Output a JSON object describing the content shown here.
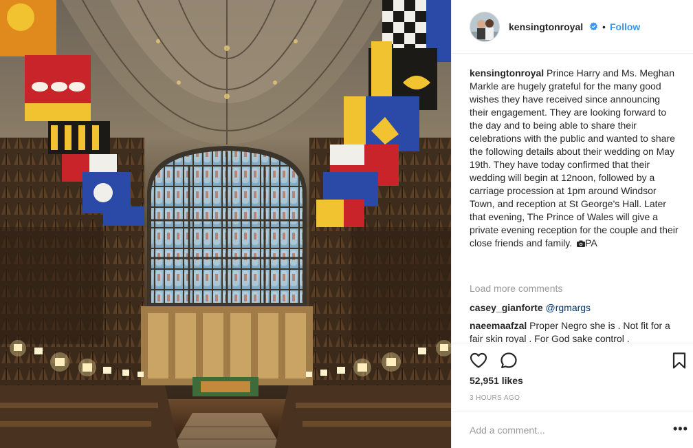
{
  "post": {
    "username": "kensingtonroyal",
    "follow_label": "Follow",
    "dot": "•",
    "verified_icon": "verified-badge-icon",
    "accent_color": "#3897f0"
  },
  "caption": {
    "username": "kensingtonroyal",
    "text": "Prince Harry and Ms. Meghan Markle are hugely grateful for the many good wishes they have received since announcing their engagement. They are looking forward to the day and to being able to share their celebrations with the public and wanted to share the following details about their wedding on May 19th. They have today confirmed that their wedding will begin at 12noon, followed by a carriage procession at 1pm around Windsor Town, and reception at St George's Hall. Later that evening, The Prince of Wales will give a private evening reception for the couple and their close friends and family.",
    "credit": "PA",
    "credit_icon": "camera-icon"
  },
  "comments": {
    "load_more_label": "Load more comments",
    "items": [
      {
        "username": "casey_gianforte",
        "mention": "@rgmargs",
        "text": ""
      },
      {
        "username": "naeemaafzal",
        "mention": "",
        "text": "Proper Negro she is . Not fit for a fair skin royal . For God sake control ."
      }
    ]
  },
  "actions": {
    "like_icon": "heart-icon",
    "comment_icon": "comment-bubble-icon",
    "save_icon": "bookmark-icon"
  },
  "stats": {
    "likes": "52,951 likes",
    "time": "3 HOURS AGO"
  },
  "composer": {
    "placeholder": "Add a comment...",
    "more_label": "•••"
  }
}
